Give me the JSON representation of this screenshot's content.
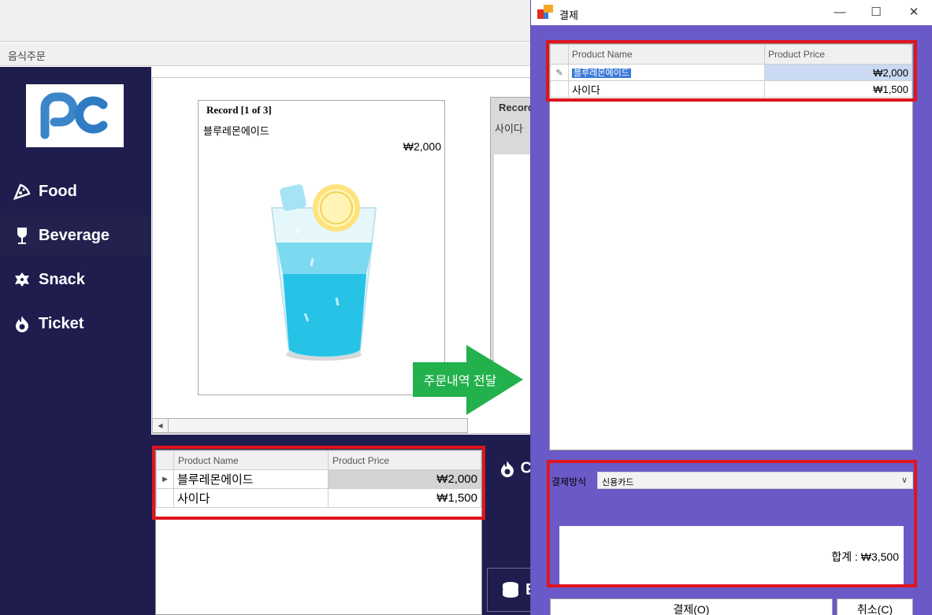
{
  "main_window": {
    "tab_label": "음식주문",
    "menu": [
      {
        "label": "Food",
        "icon": "pizza-icon"
      },
      {
        "label": "Beverage",
        "icon": "wine-glass-icon"
      },
      {
        "label": "Snack",
        "icon": "cookie-icon"
      },
      {
        "label": "Ticket",
        "icon": "flame-icon"
      }
    ],
    "logo_text": "pc",
    "card1": {
      "header": "Record [1 of 3]",
      "name": "블루레몬에이드",
      "price": "₩2,000"
    },
    "card2": {
      "header": "Record",
      "name": "사이다"
    },
    "arrow_label": "주문내역 전달",
    "order_grid": {
      "columns": [
        "Product Name",
        "Product Price"
      ],
      "rows": [
        {
          "name": "블루레몬에이드",
          "price": "₩2,000"
        },
        {
          "name": "사이다",
          "price": "₩1,500"
        }
      ]
    },
    "side_partial": {
      "label1": "C",
      "label2": "E"
    }
  },
  "dialog": {
    "title": "결제",
    "grid": {
      "columns": [
        "Product Name",
        "Product Price"
      ],
      "rows": [
        {
          "name": "블루레몬에이드",
          "price": "₩2,000"
        },
        {
          "name": "사이다",
          "price": "₩1,500"
        }
      ]
    },
    "payment_label": "결제방식",
    "payment_method": "신용카드",
    "total": "합계 : ₩3,500",
    "ok_button": "결제(O)",
    "cancel_button": "취소(C)"
  },
  "colors": {
    "sidebar": "#1e1d4e",
    "dialog_bg": "#6a5ac8",
    "highlight": "#e0141e",
    "arrow": "#22b14c"
  }
}
